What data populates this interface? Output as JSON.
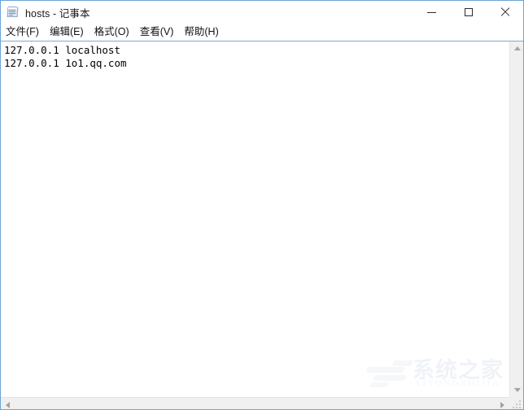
{
  "window": {
    "title": "hosts - 记事本",
    "icon": "notepad-icon",
    "border_color": "#6ba5d7",
    "background": "#ffffff"
  },
  "titlebar": {
    "controls": [
      {
        "name": "minimize",
        "glyph": "—"
      },
      {
        "name": "maximize",
        "glyph": "□"
      },
      {
        "name": "close",
        "glyph": "✕"
      }
    ]
  },
  "menubar": {
    "items": [
      {
        "label": "文件(F)"
      },
      {
        "label": "编辑(E)"
      },
      {
        "label": "格式(O)"
      },
      {
        "label": "查看(V)"
      },
      {
        "label": "帮助(H)"
      }
    ]
  },
  "editor": {
    "lines": [
      "127.0.0.1 localhost",
      "127.0.0.1 1o1.qq.com"
    ],
    "text_color": "#000000",
    "background": "#ffffff"
  },
  "scrollbars": {
    "vertical": {
      "up_arrow": "scroll-up-arrow",
      "down_arrow": "scroll-down-arrow",
      "track_color": "#f0f0f0"
    },
    "horizontal": {
      "left_arrow": "scroll-left-arrow",
      "right_arrow": "scroll-right-arrow",
      "track_color": "#f0f0f0"
    }
  },
  "watermark": {
    "chinese": "系统之家",
    "pinyin": "XITONGZHIJIA",
    "color": "#eff3f8"
  }
}
